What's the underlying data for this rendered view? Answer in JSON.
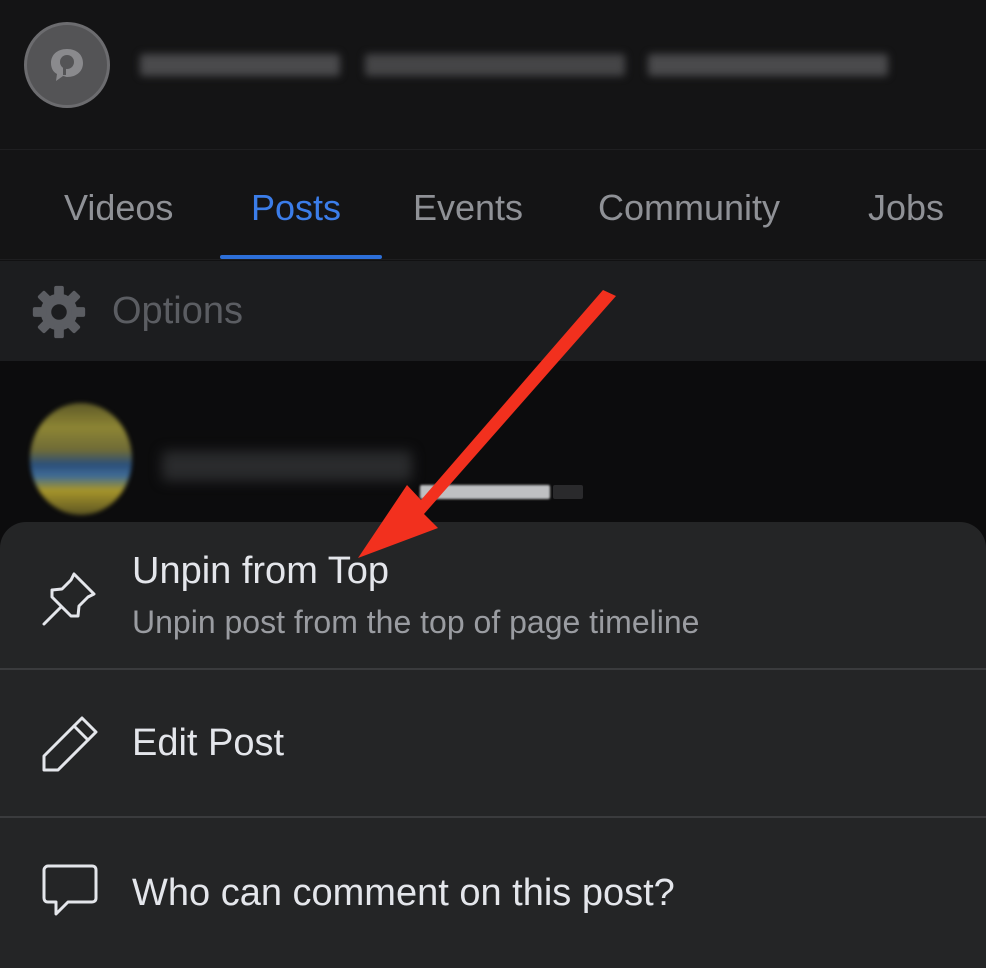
{
  "tabs": [
    {
      "label": "Videos",
      "active": false
    },
    {
      "label": "Posts",
      "active": true
    },
    {
      "label": "Events",
      "active": false
    },
    {
      "label": "Community",
      "active": false
    },
    {
      "label": "Jobs",
      "active": false
    }
  ],
  "options": {
    "label": "Options",
    "icon": "gear-icon"
  },
  "menu": {
    "items": [
      {
        "title": "Unpin from Top",
        "subtitle": "Unpin post from the top of page timeline",
        "icon": "pin-icon"
      },
      {
        "title": "Edit Post",
        "icon": "pencil-icon"
      },
      {
        "title": "Who can comment on this post?",
        "icon": "comment-icon"
      }
    ]
  },
  "colors": {
    "background": "#111112",
    "sheet": "#242526",
    "active_tab": "#3b7de9",
    "inactive_tab": "#8f9196",
    "annotation_arrow": "#f2301e"
  }
}
